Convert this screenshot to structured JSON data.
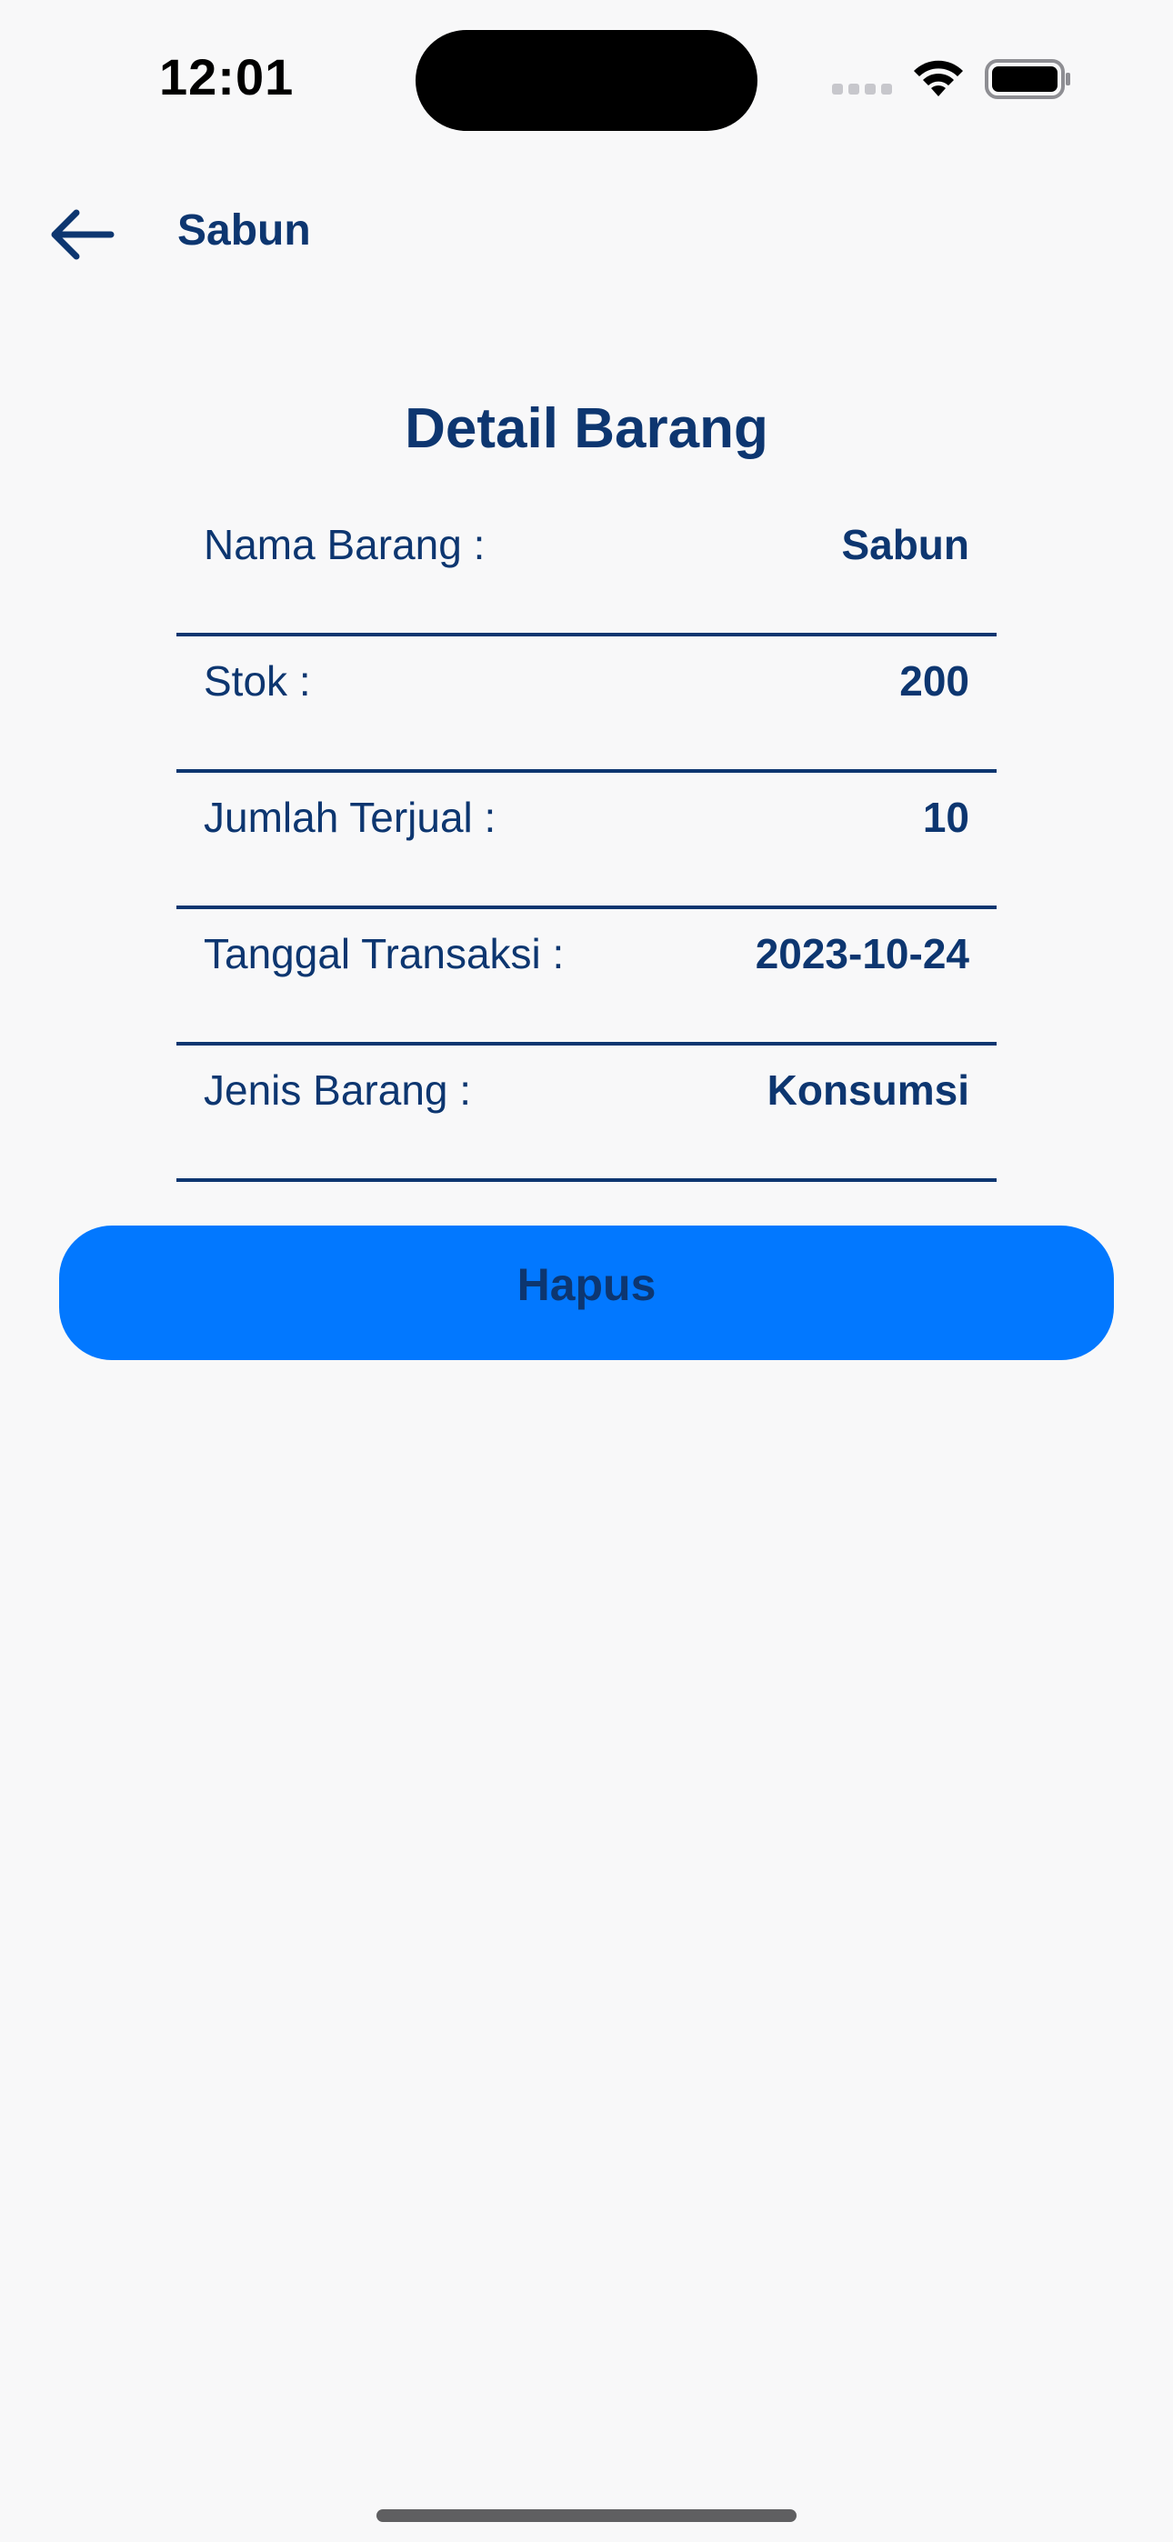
{
  "status_bar": {
    "time": "12:01"
  },
  "nav": {
    "back_icon": "arrow-left-icon",
    "title": "Sabun"
  },
  "page": {
    "title": "Detail Barang"
  },
  "details": [
    {
      "label": "Nama Barang :",
      "value": "Sabun"
    },
    {
      "label": "Stok :",
      "value": "200"
    },
    {
      "label": "Jumlah Terjual :",
      "value": "10"
    },
    {
      "label": "Tanggal Transaksi :",
      "value": "2023-10-24"
    },
    {
      "label": "Jenis Barang :",
      "value": "Konsumsi"
    }
  ],
  "actions": {
    "delete_label": "Hapus"
  },
  "colors": {
    "primary_text": "#0d3670",
    "button_background": "#0278ff",
    "background": "#f8f8f9"
  }
}
